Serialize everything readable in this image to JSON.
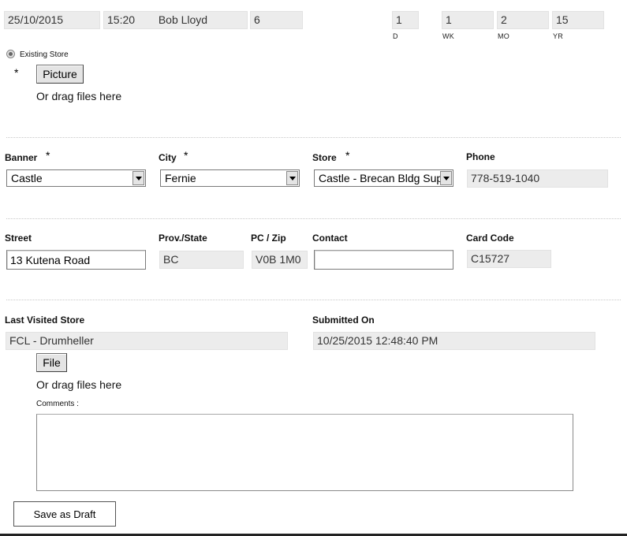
{
  "header": {
    "date": "25/10/2015",
    "time": "15:20",
    "user": "Bob Lloyd",
    "count": "6",
    "stats": [
      {
        "value": "1",
        "label": "D"
      },
      {
        "value": "1",
        "label": "WK"
      },
      {
        "value": "2",
        "label": "MO"
      },
      {
        "value": "15",
        "label": "YR"
      }
    ]
  },
  "store_type": {
    "option_label": "Existing Store"
  },
  "picture": {
    "required_mark": "*",
    "button_label": "Picture",
    "drag_hint": "Or drag files here"
  },
  "banner": {
    "label": "Banner",
    "required_mark": "*",
    "value": "Castle"
  },
  "city": {
    "label": "City",
    "required_mark": "*",
    "value": "Fernie"
  },
  "store": {
    "label": "Store",
    "required_mark": "*",
    "value": "Castle - Brecan Bldg Sup"
  },
  "phone": {
    "label": "Phone",
    "value": "778-519-1040"
  },
  "street": {
    "label": "Street",
    "value": "13 Kutena Road"
  },
  "prov_state": {
    "label": "Prov./State",
    "value": "BC"
  },
  "pc_zip": {
    "label": "PC / Zip",
    "value": "V0B 1M0"
  },
  "contact": {
    "label": "Contact",
    "value": ""
  },
  "card_code": {
    "label": "Card Code",
    "value": "C15727"
  },
  "last_visited": {
    "label": "Last Visited Store",
    "value": "FCL - Drumheller"
  },
  "submitted_on": {
    "label": "Submitted On",
    "value": "10/25/2015 12:48:40 PM"
  },
  "file": {
    "button_label": "File",
    "drag_hint": "Or drag files here"
  },
  "comments": {
    "label": "Comments :",
    "value": ""
  },
  "actions": {
    "save_draft_label": "Save as Draft"
  }
}
